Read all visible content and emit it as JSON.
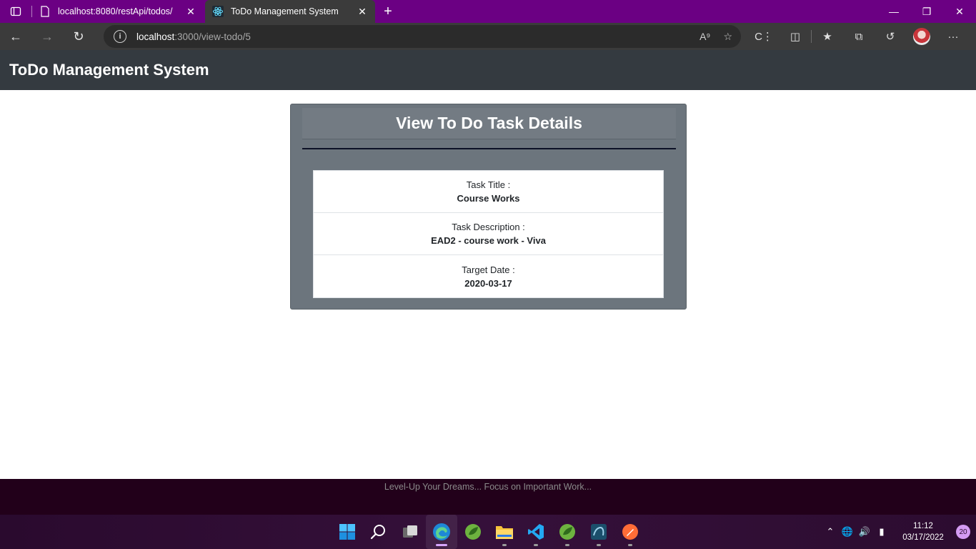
{
  "browser": {
    "tabs": [
      {
        "title": "localhost:8080/restApi/todos/",
        "icon": "document-icon",
        "active": false
      },
      {
        "title": "ToDo Management System",
        "icon": "react-icon",
        "active": true
      }
    ],
    "address": {
      "host": "localhost",
      "path": ":3000/view-todo/5"
    },
    "accent_color": "#6b0083"
  },
  "app": {
    "brand": "ToDo Management System",
    "header_color": "#343a40"
  },
  "card": {
    "title": "View To Do Task Details",
    "details": [
      {
        "label": "Task Title :",
        "value": "Course Works"
      },
      {
        "label": "Task Description :",
        "value": "EAD2 - course work - Viva"
      },
      {
        "label": "Target Date :",
        "value": "2020-03-17"
      }
    ]
  },
  "footer": {
    "text": "Level-Up Your Dreams... Focus on Important Work..."
  },
  "taskbar": {
    "time": "11:12",
    "date": "03/17/2022",
    "notifications": "20"
  }
}
